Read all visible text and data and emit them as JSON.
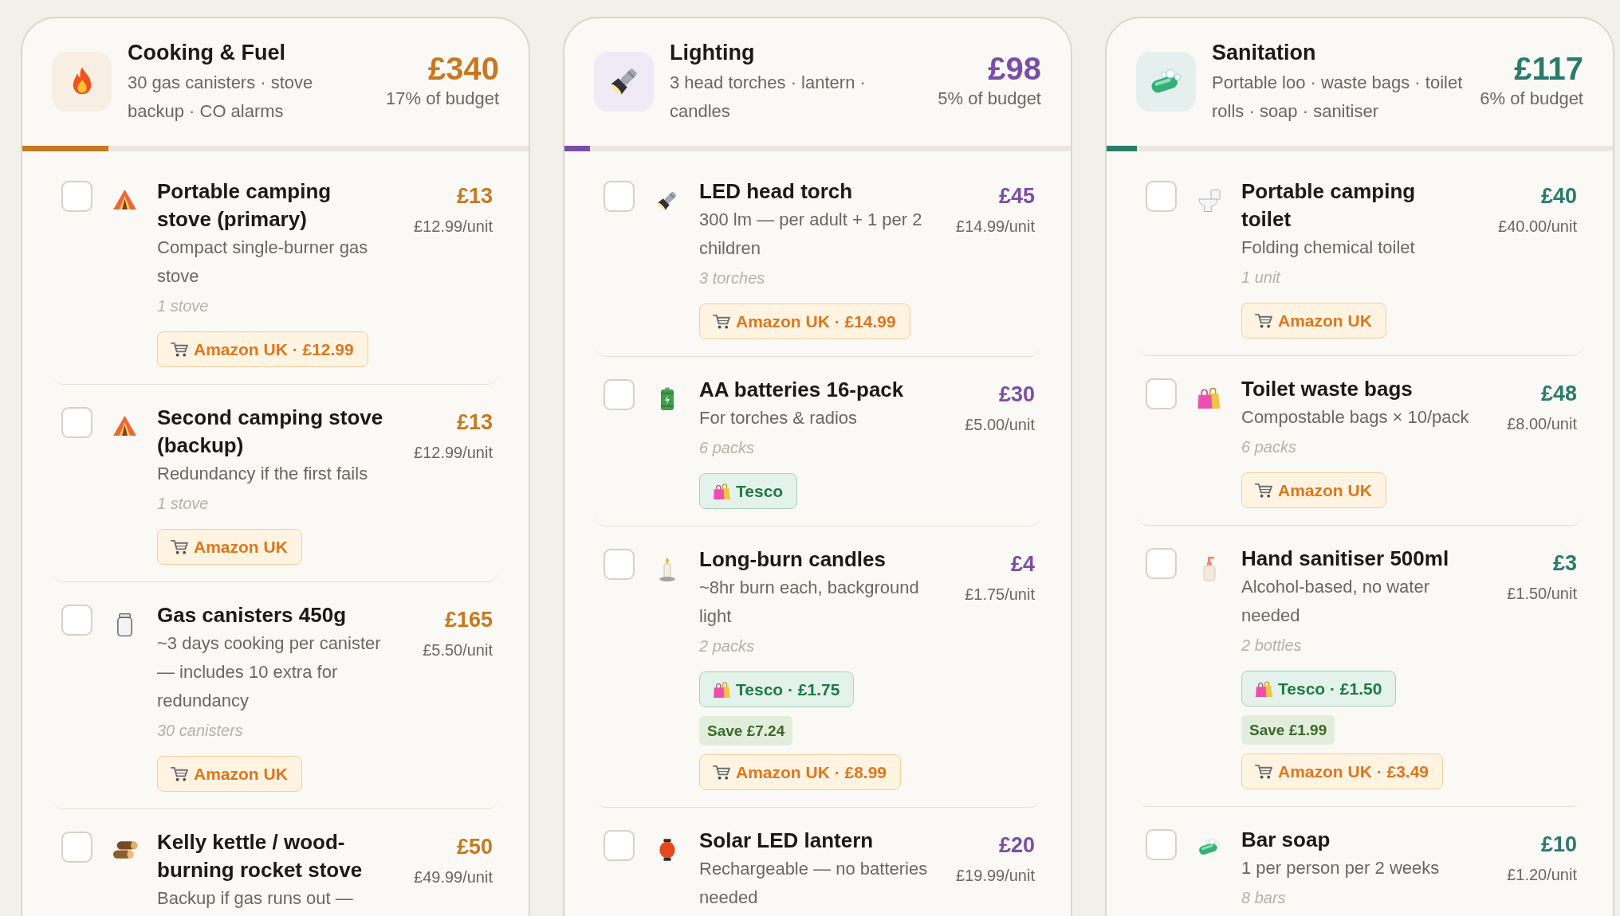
{
  "categories": [
    {
      "kind": "flame",
      "title": "Cooking & Fuel",
      "subtitle": "30 gas canisters · stove backup · CO alarms",
      "total": "£340",
      "share": "17% of budget",
      "level": 0.17,
      "color": "#c8791f",
      "items": [
        {
          "kind": "tent",
          "checked": false,
          "name": "Portable camping stove (primary)",
          "description": "Compact single-burner gas stove",
          "quantity": "1 stove",
          "price": "£13",
          "unit_price": "£12.99/unit",
          "offers": [
            {
              "kind": "amazon",
              "label": "Amazon UK · £12.99"
            }
          ]
        },
        {
          "kind": "tent",
          "checked": false,
          "name": "Second camping stove (backup)",
          "description": "Redundancy if the first fails",
          "quantity": "1 stove",
          "price": "£13",
          "unit_price": "£12.99/unit",
          "offers": [
            {
              "kind": "amazon",
              "label": "Amazon UK"
            }
          ]
        },
        {
          "kind": "jar",
          "checked": false,
          "name": "Gas canisters 450g",
          "description": "~3 days cooking per canister — includes 10 extra for redundancy",
          "quantity": "30 canisters",
          "price": "£165",
          "unit_price": "£5.50/unit",
          "offers": [
            {
              "kind": "amazon",
              "label": "Amazon UK"
            }
          ]
        },
        {
          "kind": "logs",
          "checked": false,
          "name": "Kelly kettle / wood-burning rocket stove",
          "description": "Backup if gas runs out —",
          "price": "£50",
          "unit_price": "£49.99/unit"
        }
      ]
    },
    {
      "kind": "flashlight",
      "title": "Lighting",
      "subtitle": "3 head torches · lantern · candles",
      "total": "£98",
      "share": "5% of budget",
      "level": 0.05,
      "color": "#7a4ea8",
      "items": [
        {
          "kind": "flashlight",
          "checked": false,
          "name": "LED head torch",
          "description": "300 lm — per adult + 1 per 2 children",
          "quantity": "3 torches",
          "price": "£45",
          "unit_price": "£14.99/unit",
          "offers": [
            {
              "kind": "amazon",
              "label": "Amazon UK · £14.99"
            }
          ]
        },
        {
          "kind": "battery",
          "checked": false,
          "name": "AA batteries 16-pack",
          "description": "For torches & radios",
          "quantity": "6 packs",
          "price": "£30",
          "unit_price": "£5.00/unit",
          "offers": [
            {
              "kind": "tesco",
              "label": "Tesco"
            }
          ]
        },
        {
          "kind": "candle",
          "checked": false,
          "name": "Long-burn candles",
          "description": "~8hr burn each, background light",
          "quantity": "2 packs",
          "price": "£4",
          "unit_price": "£1.75/unit",
          "offers": [
            {
              "kind": "tesco",
              "label": "Tesco · £1.75"
            },
            {
              "kind": "save",
              "label": "Save £7.24"
            },
            {
              "kind": "amazon",
              "label": "Amazon UK · £8.99"
            }
          ]
        },
        {
          "kind": "lantern",
          "checked": false,
          "name": "Solar LED lantern",
          "description": "Rechargeable — no batteries needed",
          "price": "£20",
          "unit_price": "£19.99/unit"
        }
      ]
    },
    {
      "kind": "soap",
      "title": "Sanitation",
      "subtitle": "Portable loo · waste bags · toilet rolls · soap · sanitiser",
      "total": "£117",
      "share": "6% of budget",
      "level": 0.06,
      "color": "#2a7b6a",
      "items": [
        {
          "kind": "toilet",
          "checked": false,
          "name": "Portable camping toilet",
          "description": "Folding chemical toilet",
          "quantity": "1 unit",
          "price": "£40",
          "unit_price": "£40.00/unit",
          "offers": [
            {
              "kind": "amazon",
              "label": "Amazon UK"
            }
          ]
        },
        {
          "kind": "bags",
          "checked": false,
          "name": "Toilet waste bags",
          "description": "Compostable bags × 10/pack",
          "quantity": "6 packs",
          "price": "£48",
          "unit_price": "£8.00/unit",
          "offers": [
            {
              "kind": "amazon",
              "label": "Amazon UK"
            }
          ]
        },
        {
          "kind": "bottle",
          "checked": false,
          "name": "Hand sanitiser 500ml",
          "description": "Alcohol-based, no water needed",
          "quantity": "2 bottles",
          "price": "£3",
          "unit_price": "£1.50/unit",
          "offers": [
            {
              "kind": "tesco",
              "label": "Tesco · £1.50"
            },
            {
              "kind": "save",
              "label": "Save £1.99"
            },
            {
              "kind": "amazon",
              "label": "Amazon UK · £3.49"
            }
          ]
        },
        {
          "kind": "soap",
          "checked": false,
          "name": "Bar soap",
          "description": "1 per person per 2 weeks",
          "quantity": "8 bars",
          "price": "£10",
          "unit_price": "£1.20/unit"
        }
      ]
    }
  ]
}
